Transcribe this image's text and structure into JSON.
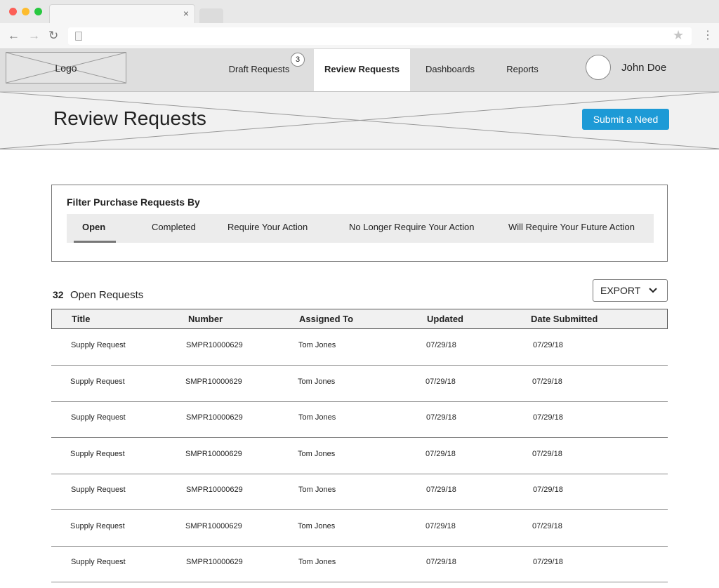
{
  "browser": {
    "tab_close": "×",
    "back_icon": "←",
    "forward_icon": "→",
    "reload_icon": "↻",
    "star_icon": "★",
    "menu_icon": "⋮"
  },
  "nav": {
    "logo": "Logo",
    "items": [
      {
        "label": "Draft Requests",
        "badge": "3"
      },
      {
        "label": "Review Requests"
      },
      {
        "label": "Dashboards"
      },
      {
        "label": "Reports"
      }
    ],
    "user_name": "John Doe"
  },
  "header": {
    "title": "Review Requests",
    "submit_label": "Submit a Need"
  },
  "filter": {
    "title": "Filter Purchase Requests By",
    "tabs": [
      "Open",
      "Completed",
      "Require Your Action",
      "No Longer Require Your Action",
      "Will Require Your Future Action"
    ]
  },
  "requests": {
    "count": "32",
    "label": "Open Requests",
    "export_label": "EXPORT"
  },
  "table": {
    "columns": [
      "Title",
      "Number",
      "Assigned To",
      "Updated",
      "Date Submitted"
    ],
    "rows": [
      [
        "Supply Request",
        "SMPR10000629",
        "Tom Jones",
        "07/29/18",
        "07/29/18"
      ],
      [
        "Supply Request",
        "SMPR10000629",
        "Tom Jones",
        "07/29/18",
        "07/29/18"
      ],
      [
        "Supply Request",
        "SMPR10000629",
        "Tom Jones",
        "07/29/18",
        "07/29/18"
      ],
      [
        "Supply Request",
        "SMPR10000629",
        "Tom Jones",
        "07/29/18",
        "07/29/18"
      ],
      [
        "Supply Request",
        "SMPR10000629",
        "Tom Jones",
        "07/29/18",
        "07/29/18"
      ],
      [
        "Supply Request",
        "SMPR10000629",
        "Tom Jones",
        "07/29/18",
        "07/29/18"
      ],
      [
        "Supply Request",
        "SMPR10000629",
        "Tom Jones",
        "07/29/18",
        "07/29/18"
      ]
    ]
  },
  "colors": {
    "accent": "#1d9ad6",
    "nav_bg": "#dedede",
    "banner_bg": "#f1f1f1"
  }
}
